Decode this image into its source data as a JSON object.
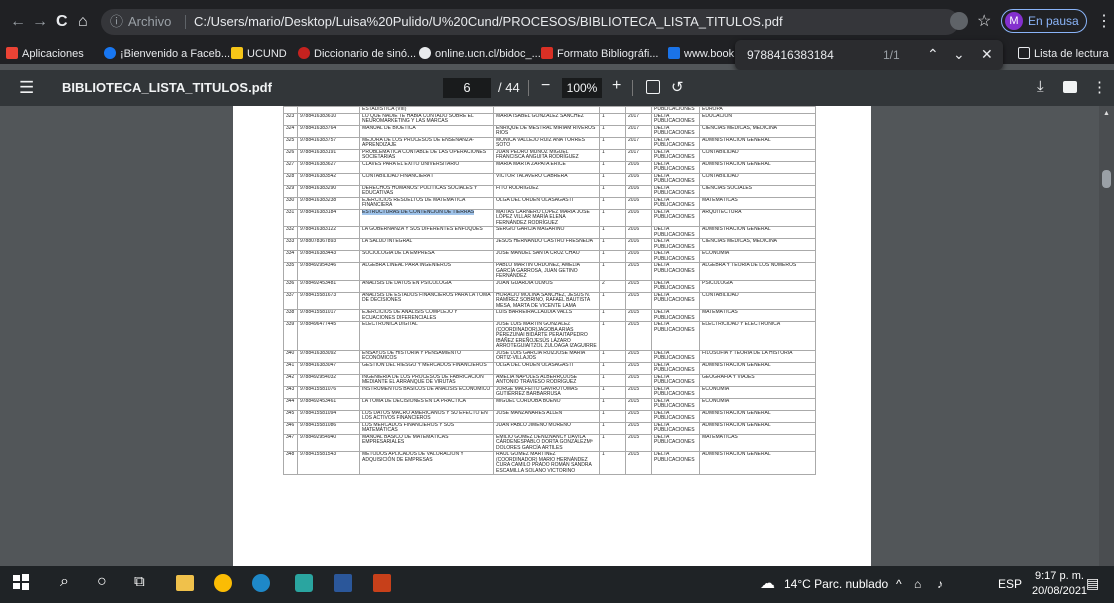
{
  "browser": {
    "nav": {
      "back": "←",
      "forward": "→",
      "reload": "C",
      "home": "⌂"
    },
    "info_icon": "ⓘ",
    "archivo_label": "Archivo",
    "url": "C:/Users/mario/Desktop/Luisa%20Pulido/U%20Cund/PROCESOS/BIBLIOTECA_LISTA_TITULOS.pdf",
    "profile_initial": "M",
    "profile_status": "En pausa",
    "menu": "⋮"
  },
  "bookmarks": [
    {
      "label": "Aplicaciones",
      "color": "#ea4335"
    },
    {
      "label": "¡Bienvenido a Faceb...",
      "color": "#1877f2"
    },
    {
      "label": "UCUND",
      "color": "#f5c518"
    },
    {
      "label": "Diccionario de sinó...",
      "color": "#e8eaed"
    },
    {
      "label": "online.ucn.cl/bidoc_...",
      "color": "#e8eaed"
    },
    {
      "label": "Formato Bibliográfi...",
      "color": "#d93025"
    },
    {
      "label": "www.book.t",
      "color": "#1a73e8"
    }
  ],
  "reading_list": "Lista de lectura",
  "find": {
    "query": "9788416383184",
    "count": "1/1"
  },
  "pdf": {
    "title": "BIBLIOTECA_LISTA_TITULOS.pdf",
    "page_current": "6",
    "page_total": "/ 44",
    "zoom": "100%"
  },
  "table_rows": [
    {
      "n": "",
      "isbn": "",
      "titulo": "ESTADÍSTICA (VIII)",
      "autor": "",
      "ed": "",
      "anio": "",
      "editorial": "PUBLICACIONES",
      "area": "EUROPA"
    },
    {
      "n": "323",
      "isbn": "9788416383610",
      "titulo": "LO QUE NADIE TE HABÍA CONTADO SOBRE EL NEUROMARKETING Y LAS MARCAS",
      "autor": "MARÍA ISABEL GONZÁLEZ SÁNCHEZ",
      "ed": "1",
      "anio": "2017",
      "editorial": "DELTA PUBLICACIONES",
      "area": "EDUCACIÓN"
    },
    {
      "n": "324",
      "isbn": "9788416383764",
      "titulo": "MANUAL DE BIOÉTICA",
      "autor": "ENRIQUE DE MESTRAL MIRIAM RIVEROS RIOS",
      "ed": "1",
      "anio": "2017",
      "editorial": "DELTA PUBLICACIONES",
      "area": "CIENCIAS MÉDICAS, MEDICINA"
    },
    {
      "n": "325",
      "isbn": "9788416383757",
      "titulo": "MEJORA DE LOS PROCESOS DE ENSEÑANZA-APRENDIZAJE",
      "autor": "MÓNICA VALLEJO RUIZ ANA TORRES SOTO",
      "ed": "1",
      "anio": "2017",
      "editorial": "DELTA PUBLICACIONES",
      "area": "ADMINISTRACIÓN GENERAL"
    },
    {
      "n": "326",
      "isbn": "9788416383191",
      "titulo": "PROBLEMÁTICA CONTABLE DE LAS OPERACIONES SOCIETARIAS",
      "autor": "JUAN PEDRO MUÑOZ MIGUEL FRANCISCA ANGUITA RODRÍGUEZ",
      "ed": "1",
      "anio": "2017",
      "editorial": "DELTA PUBLICACIONES",
      "area": "CONTABILIDAD"
    },
    {
      "n": "327",
      "isbn": "9788416383627",
      "titulo": "CLAVES PARA EL ÉXITO UNIVERSITARIO",
      "autor": "MARÍA MARTA ZAPATA ERICE",
      "ed": "1",
      "anio": "2016",
      "editorial": "DELTA PUBLICACIONES",
      "area": "ADMINISTRACIÓN GENERAL"
    },
    {
      "n": "328",
      "isbn": "9788416383542",
      "titulo": "CONTABILIDAD FINANCIERA I",
      "autor": "VÍCTOR TALAVERO CABRERA",
      "ed": "1",
      "anio": "2016",
      "editorial": "DELTA PUBLICACIONES",
      "area": "CONTABILIDAD"
    },
    {
      "n": "329",
      "isbn": "9788416383290",
      "titulo": "DERECHOS HUMANOS: POLÍTICAS SOCIALES Y EDUCATIVAS",
      "autor": "FITO RODRÍGUEZ",
      "ed": "1",
      "anio": "2016",
      "editorial": "DELTA PUBLICACIONES",
      "area": "CIENCIAS SOCIALES"
    },
    {
      "n": "330",
      "isbn": "9788416383238",
      "titulo": "EJERCICIOS RESUELTOS DE MATEMÁTICA FINANCIERA",
      "autor": "OLGA DEL ORDEN OLASAGASTI",
      "ed": "1",
      "anio": "2016",
      "editorial": "DELTA PUBLICACIONES",
      "area": "MATEMÁTICAS"
    },
    {
      "n": "331",
      "isbn": "9788416383184",
      "titulo": "ESTRUCTURAS DE CONTENCIÓN DE TIERRAS",
      "autor": "MATÍAS CARNERO LÓPEZ MARÍA JOSÉ LÓPEZ VILLAR MARÍA ELENA FERNÁNDEZ RODRÍGUEZ",
      "ed": "1",
      "anio": "2016",
      "editorial": "DELTA PUBLICACIONES",
      "area": "ARQUITECTURA",
      "hl": true
    },
    {
      "n": "332",
      "isbn": "9788416383122",
      "titulo": "LA GOBERNANZA Y SUS DIFERENTES ENFOQUES",
      "autor": "SERGIO GARCÍA MAGARIÑO",
      "ed": "1",
      "anio": "2016",
      "editorial": "DELTA PUBLICACIONES",
      "area": "ADMINISTRACIÓN GENERAL"
    },
    {
      "n": "333",
      "isbn": "9788078367893",
      "titulo": "LA SALUD INTEGRAL",
      "autor": "JESÚS HERNANDO CASTRO FRESNEDA",
      "ed": "1",
      "anio": "2016",
      "editorial": "DELTA PUBLICACIONES",
      "area": "CIENCIAS MÉDICAS, MEDICINA"
    },
    {
      "n": "334",
      "isbn": "9788416383443",
      "titulo": "SOCIOLOGÍA DE LA EMPRESA",
      "autor": "JOSÉ MANUEL SANTA CRUZ CHAO",
      "ed": "1",
      "anio": "2016",
      "editorial": "DELTA PUBLICACIONES",
      "area": "ECONOMÍA"
    },
    {
      "n": "335",
      "isbn": "9788492954346",
      "titulo": "ÁLGEBRA LINEAL PARA INGENIEROS",
      "autor": "PABLO MARTÍN ORDÓÑEZ, AMELIA GARCÍA GARROSA, JUAN GETINO FERNÁNDEZ",
      "ed": "1",
      "anio": "2015",
      "editorial": "DELTA PUBLICACIONES",
      "area": "ÁLGEBRA Y TEORÍA DE LOS NÚMEROS"
    },
    {
      "n": "336",
      "isbn": "9788492453481",
      "titulo": "ANÁLISIS DE DATOS EN PSICOLOGÍA",
      "autor": "JOAN GUARDIA OLMOS",
      "ed": "2",
      "anio": "2015",
      "editorial": "DELTA PUBLICACIONES",
      "area": "PSICOLOGÍA"
    },
    {
      "n": "337",
      "isbn": "9788415581673",
      "titulo": "ANÁLISIS DE ESTADOS FINANCIEROS PARA LA TOMA DE DECISIONES",
      "autor": "HORACIO MOLINA SÁNCHEZ, JESÚS N. RAMÍREZ SOBRINO, RAFAEL BAUTISTA MESA, MARTA DE VICENTE LAMA",
      "ed": "1",
      "anio": "2015",
      "editorial": "DELTA PUBLICACIONES",
      "area": "CONTABILIDAD"
    },
    {
      "n": "338",
      "isbn": "9788415581017",
      "titulo": "EJERCICIOS DE ANÁLISIS COMPLEJO Y ECUACIONES DIFERENCIALES",
      "autor": "LUIS BARREIRACLAUDIA VALLS",
      "ed": "1",
      "anio": "2015",
      "editorial": "DELTA PUBLICACIONES",
      "area": "MATEMÁTICAS"
    },
    {
      "n": "339",
      "isbn": "9788496477445",
      "titulo": "ELECTRÓNICA DIGITAL",
      "autor": "JOSÉ LUIS MARTÍN GONZÁLEZ (COORDINADOR)JAGOBA ARIAS PÉREZUNAI BIDARTE PERAITAPEDRO IBÁÑEZ EREÑOJESÚS LÁZARO ARROTEGUIAITZOL ZULOAGA IZAGUIRRE",
      "ed": "1",
      "anio": "2015",
      "editorial": "DELTA PUBLICACIONES",
      "area": "ELECTRICIDAD Y ELECTRÓNICA"
    },
    {
      "n": "340",
      "isbn": "9788416383092",
      "titulo": "ENSAYOS DE HISTORIA Y PENSAMIENTO ECONÓMICOS",
      "autor": "JOSÉ LUIS GARCÍA RUIZJOSÉ MARÍA ORTIZ-VILLAJOS",
      "ed": "1",
      "anio": "2015",
      "editorial": "DELTA PUBLICACIONES",
      "area": "FILOSOFÍA Y TEORÍA DE LA HISTORIA"
    },
    {
      "n": "341",
      "isbn": "9788416383047",
      "titulo": "GESTIÓN DEL RIESGO Y MERCADOS FINANCIEROS",
      "autor": "OLGA DEL ORDEN OLASAGASTI",
      "ed": "1",
      "anio": "2015",
      "editorial": "DELTA PUBLICACIONES",
      "area": "ADMINISTRACIÓN GENERAL"
    },
    {
      "n": "342",
      "isbn": "9788492954032",
      "titulo": "INGENIERÍA DE LOS PROCESOS DE FABRICACIÓN MEDIANTE EL ARRANQUE DE VIRUTAS",
      "autor": "AMELIA NÁPOLES ALBERROJOSÉ ANTONIO TRAVIESO RODRÍGUEZ",
      "ed": "1",
      "anio": "2015",
      "editorial": "DELTA PUBLICACIONES",
      "area": "GEOGRAFÍA Y VIAJES"
    },
    {
      "n": "343",
      "isbn": "9788415581076",
      "titulo": "INSTRUMENTOS BÁSICOS DE ANÁLISIS ECONÓMICO",
      "autor": "JORGE MALFEITO GAVIROTOMÁS GUTIÉRREZ BARBARRUSA",
      "ed": "1",
      "anio": "2015",
      "editorial": "DELTA PUBLICACIONES",
      "area": "ECONOMÍA"
    },
    {
      "n": "344",
      "isbn": "9788492453461",
      "titulo": "LA TOMA DE DECISIONES EN LA PRÁCTICA",
      "autor": "MIGUEL CÓRDOBA BUENO",
      "ed": "1",
      "anio": "2015",
      "editorial": "DELTA PUBLICACIONES",
      "area": "ECONOMÍA"
    },
    {
      "n": "345",
      "isbn": "9788415581094",
      "titulo": "LOS DATOS MACRO AMERICANOS Y SU EFECTO EN LOS ACTIVOS FINANCIEROS",
      "autor": "JOSÉ MANZANARES ALLÉN",
      "ed": "1",
      "anio": "2015",
      "editorial": "DELTA PUBLICACIONES",
      "area": "ADMINISTRACIÓN GENERAL"
    },
    {
      "n": "346",
      "isbn": "9788415581086",
      "titulo": "LOS MERCADOS FINANCIEROS Y SUS MATEMÁTICAS",
      "autor": "JUAN PABLO JIMENO MORENO",
      "ed": "1",
      "anio": "2015",
      "editorial": "DELTA PUBLICACIONES",
      "area": "ADMINISTRACIÓN GENERAL"
    },
    {
      "n": "347",
      "isbn": "9788492954940",
      "titulo": "MANUAL BÁSICO DE MATEMÁTICAS EMPRESARIALES",
      "autor": "EMILIO GÓMEZ DÉNIZNANCY DÁVILA CÁRDENESPABLO DORTA GONZÁLEZMª DOLORES GARCÍA ARTILES",
      "ed": "1",
      "anio": "2015",
      "editorial": "DELTA PUBLICACIONES",
      "area": "MATEMÁTICAS"
    },
    {
      "n": "348",
      "isbn": "9788415581543",
      "titulo": "MÉTODOS APLICADOS DE VALORACIÓN Y ADQUISICIÓN DE EMPRESAS",
      "autor": "RAÚL GÓMEZ MARTÍNEZ (COORDINADOR) MARIO HERNÁNDEZ CURA CAMILO PRADO ROMÁN SANDRA ESCAMILLA SOLANO VICTORINO",
      "ed": "1",
      "anio": "2015",
      "editorial": "DELTA PUBLICACIONES",
      "area": "ADMINISTRACIÓN GENERAL"
    }
  ],
  "taskbar": {
    "weather": "14°C  Parc. nublado",
    "lang": "ESP",
    "time": "9:17 p. m.",
    "date": "20/08/2021"
  }
}
